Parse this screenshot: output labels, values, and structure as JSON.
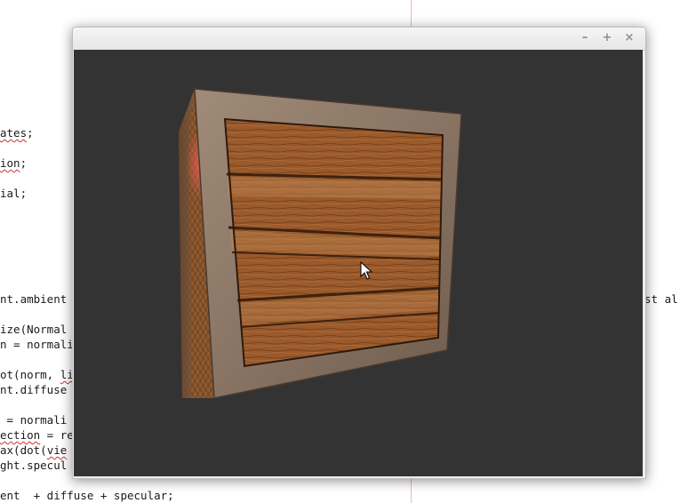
{
  "editor": {
    "lines": [
      {
        "before": "",
        "squiggle": "ates",
        "after": ";"
      },
      {
        "before": "",
        "squiggle": "ion",
        "after": ";"
      },
      {
        "before": "ial;",
        "squiggle": "",
        "after": ""
      },
      {
        "before": "nt.ambient",
        "squiggle": "",
        "after": ""
      },
      {
        "before": "ize(Normal",
        "squiggle": "",
        "after": ""
      },
      {
        "before": "n = normali",
        "squiggle": "",
        "after": ""
      },
      {
        "before": "ot(norm, ",
        "squiggle": "li",
        "after": ""
      },
      {
        "before": "nt.diffuse",
        "squiggle": "",
        "after": ""
      },
      {
        "before": " = normali",
        "squiggle": "",
        "after": ""
      },
      {
        "before": "",
        "squiggle": "ection",
        "after": " = re"
      },
      {
        "before": "ax(dot(",
        "squiggle": "vie",
        "after": ""
      },
      {
        "before": "ght.specul",
        "squiggle": "",
        "after": ""
      },
      {
        "before": "ent  + diffuse + specular;",
        "squiggle": "",
        "after": ""
      }
    ],
    "right_fragment": "st al"
  },
  "window": {
    "minimize_glyph": "–",
    "maximize_glyph": "+",
    "close_glyph": "×",
    "viewport_color": "#333333"
  },
  "scene": {
    "object": "wooden-crate",
    "crate_colors": {
      "wood": "#9a5a2c",
      "frame": "#8a7b6e",
      "light_highlight": "#e05050"
    }
  }
}
